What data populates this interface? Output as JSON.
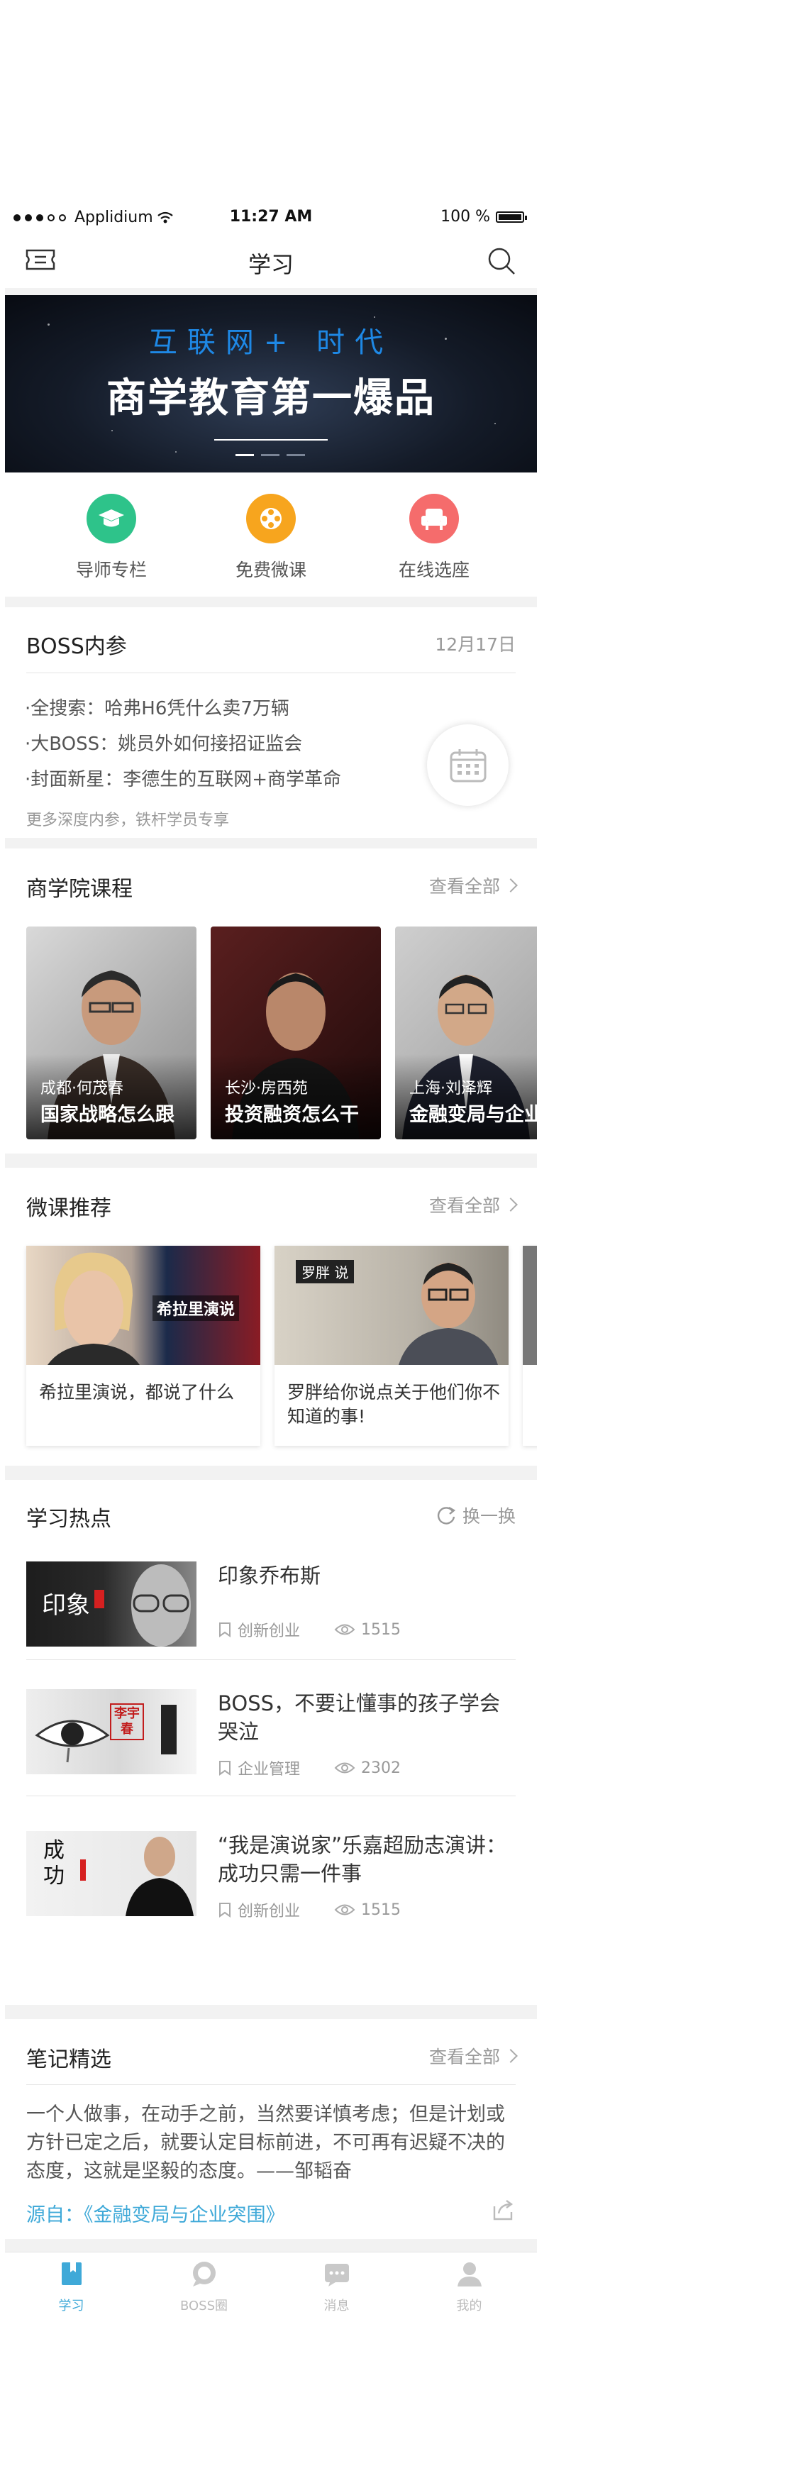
{
  "status_bar": {
    "carrier": "Applidium",
    "time": "11:27 AM",
    "battery": "100 %"
  },
  "nav": {
    "title": "学习",
    "left_icon": "ticket-icon",
    "right_icon": "search-icon"
  },
  "banner": {
    "subtitle": "互联网+ 时代",
    "title": "商学教育第一爆品",
    "pages": 3,
    "active_page": 0
  },
  "quick_links": [
    {
      "label": "导师专栏",
      "icon": "graduation-cap-icon",
      "color": "#2ec38a"
    },
    {
      "label": "免费微课",
      "icon": "film-reel-icon",
      "color": "#f7a51e"
    },
    {
      "label": "在线选座",
      "icon": "armchair-icon",
      "color": "#f56c6c"
    }
  ],
  "boss": {
    "title": "BOSS内参",
    "date": "12月17日",
    "items": [
      "·全搜索：哈弗H6凭什么卖7万辆",
      "·大BOSS：姚员外如何接招证监会",
      "·封面新星：李德生的互联网+商学革命"
    ],
    "footer": "更多深度内参，铁杆学员专享"
  },
  "courses": {
    "title": "商学院课程",
    "more": "查看全部",
    "items": [
      {
        "city": "成都·何茂春",
        "title": "国家战略怎么跟"
      },
      {
        "city": "长沙·房西苑",
        "title": "投资融资怎么干"
      },
      {
        "city": "上海·刘泽辉",
        "title": "金融变局与企业"
      }
    ]
  },
  "micro": {
    "title": "微课推荐",
    "more": "查看全部",
    "items": [
      {
        "caption": "希拉里演说，都说了什么",
        "image_text": "希拉里演说"
      },
      {
        "caption": "罗胖给你说点关于他们你不知道的事!",
        "image_text": "罗胖 说"
      }
    ]
  },
  "hot": {
    "title": "学习热点",
    "refresh": "换一换",
    "items": [
      {
        "title": "印象乔布斯",
        "tag": "创新创业",
        "views": "1515",
        "image_text": "印象"
      },
      {
        "title": "BOSS，不要让懂事的孩子学会哭泣",
        "tag": "企业管理",
        "views": "2302",
        "image_text": "李宇春"
      },
      {
        "title": "“我是演说家”乐嘉超励志演讲：成功只需一件事",
        "tag": "创新创业",
        "views": "1515",
        "image_text": "成功"
      }
    ]
  },
  "notes": {
    "title": "笔记精选",
    "more": "查看全部",
    "content": "一个人做事，在动手之前，当然要详慎考虑；但是计划或方针已定之后，就要认定目标前进，不可再有迟疑不决的态度，这就是坚毅的态度。——邹韬奋",
    "source": "源自：《金融变局与企业突围》"
  },
  "tabs": [
    {
      "label": "学习",
      "icon": "book-icon",
      "active": true
    },
    {
      "label": "BOSS圈",
      "icon": "chat-bubble-icon",
      "active": false
    },
    {
      "label": "消息",
      "icon": "message-icon",
      "active": false
    },
    {
      "label": "我的",
      "icon": "user-icon",
      "active": false
    }
  ],
  "colors": {
    "accent": "#3fa9d8",
    "background": "#f2f2f2"
  }
}
